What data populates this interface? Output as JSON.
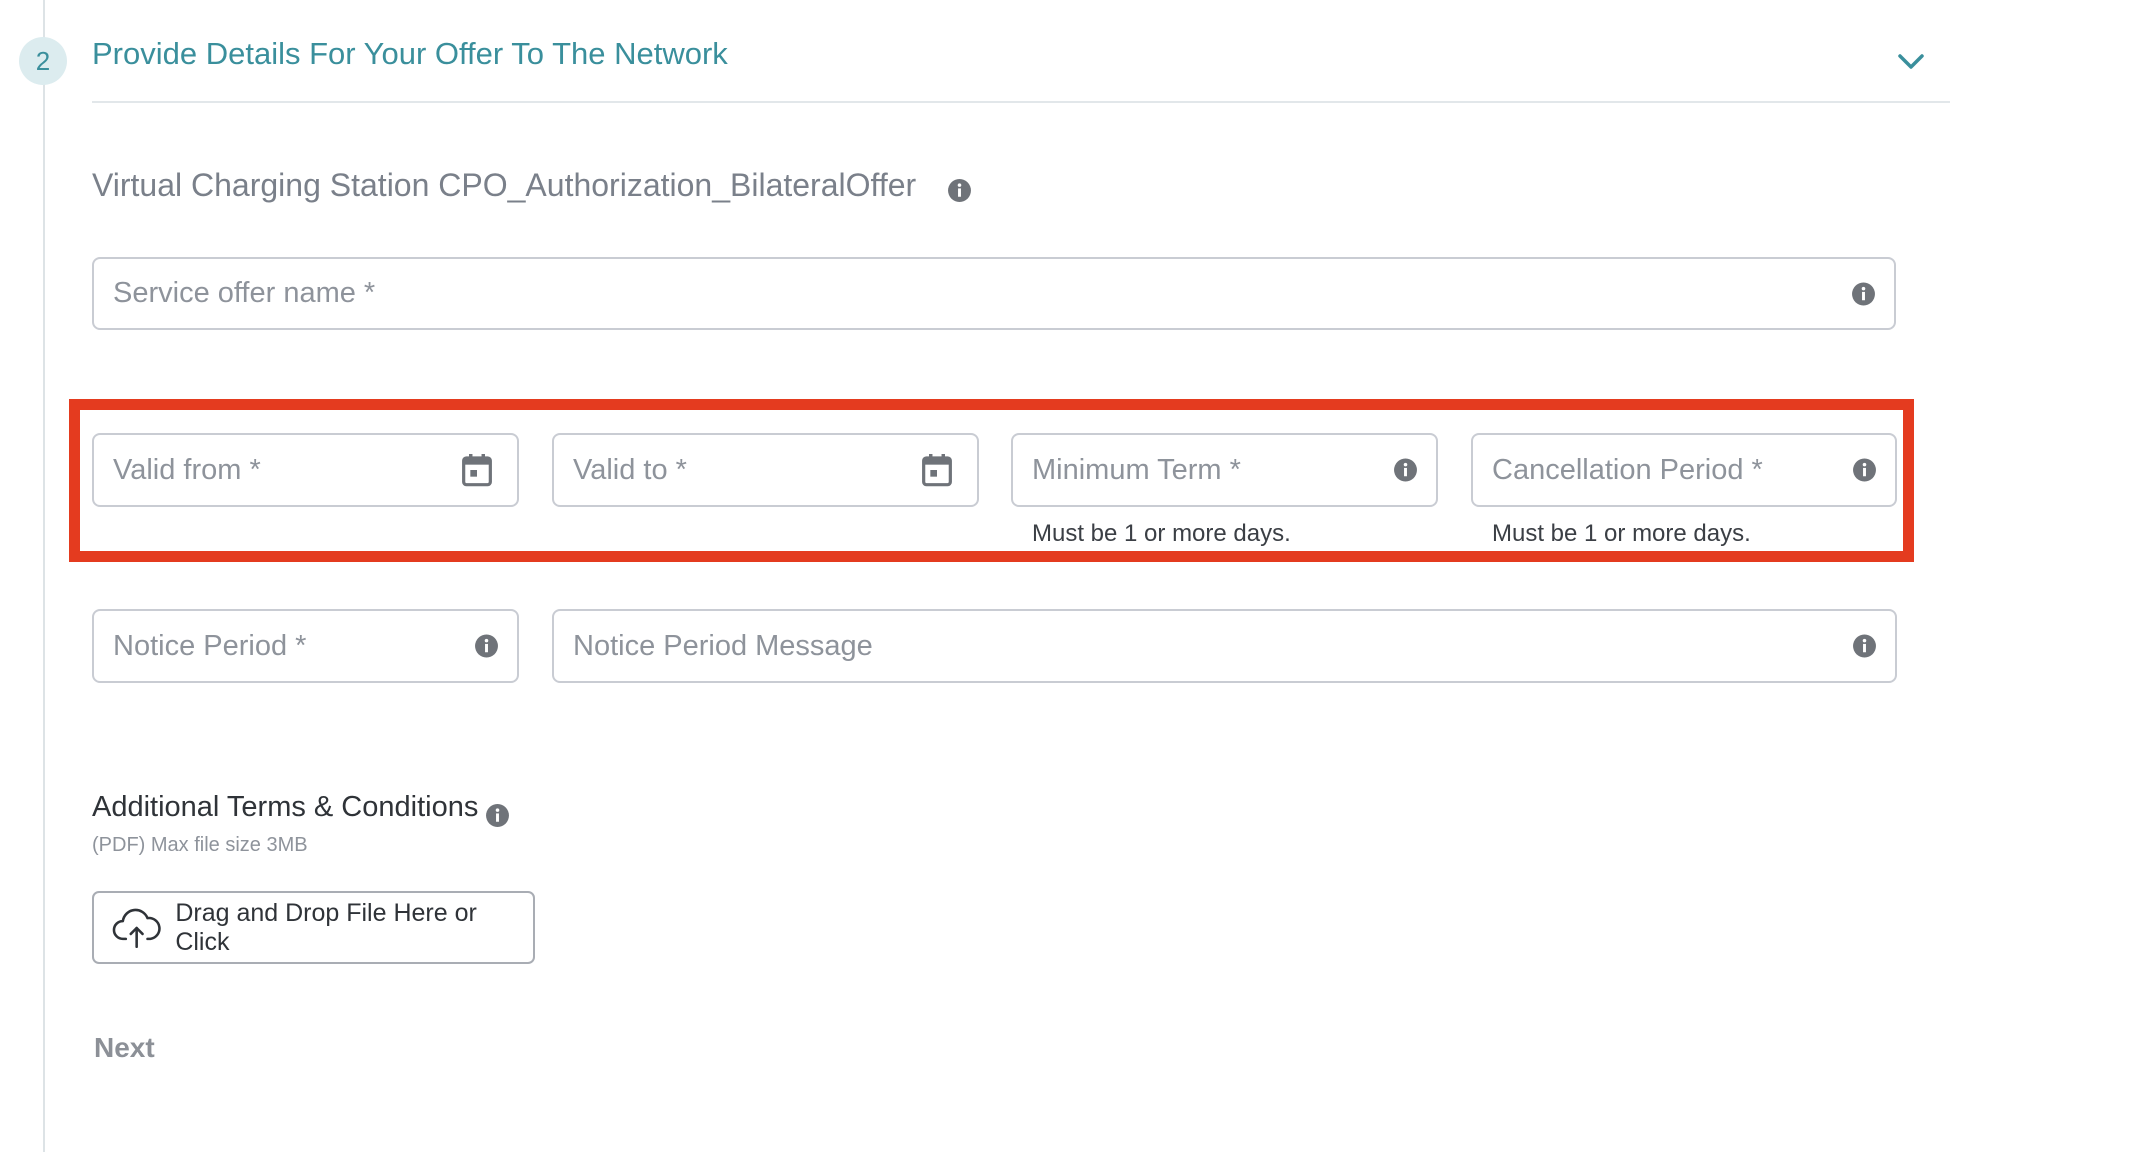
{
  "step": {
    "number": "2",
    "title": "Provide Details For Your Offer To The Network",
    "icon": "chevron-down-icon"
  },
  "offer": {
    "subtitle": "Virtual Charging Station CPO_Authorization_BilateralOffer"
  },
  "fields": {
    "service_offer_name": {
      "placeholder": "Service offer name *",
      "value": ""
    },
    "valid_from": {
      "placeholder": "Valid from *",
      "value": "",
      "icon": "calendar-icon"
    },
    "valid_to": {
      "placeholder": "Valid to *",
      "value": "",
      "icon": "calendar-icon"
    },
    "minimum_term": {
      "placeholder": "Minimum Term *",
      "value": "",
      "helper": "Must be 1 or more days."
    },
    "cancellation_period": {
      "placeholder": "Cancellation Period *",
      "value": "",
      "helper": "Must be 1 or more days."
    },
    "notice_period": {
      "placeholder": "Notice Period *",
      "value": ""
    },
    "notice_period_message": {
      "placeholder": "Notice Period Message",
      "value": ""
    }
  },
  "terms": {
    "title": "Additional Terms & Conditions",
    "subtitle": "(PDF) Max file size 3MB",
    "upload_label": "Drag and Drop File Here or Click",
    "upload_icon": "cloud-upload-icon"
  },
  "actions": {
    "next_label": "Next"
  },
  "colors": {
    "accent": "#3a8f9c",
    "highlight": "#e43b1f",
    "border": "#c9ccd3",
    "muted_text": "#8e939b"
  }
}
